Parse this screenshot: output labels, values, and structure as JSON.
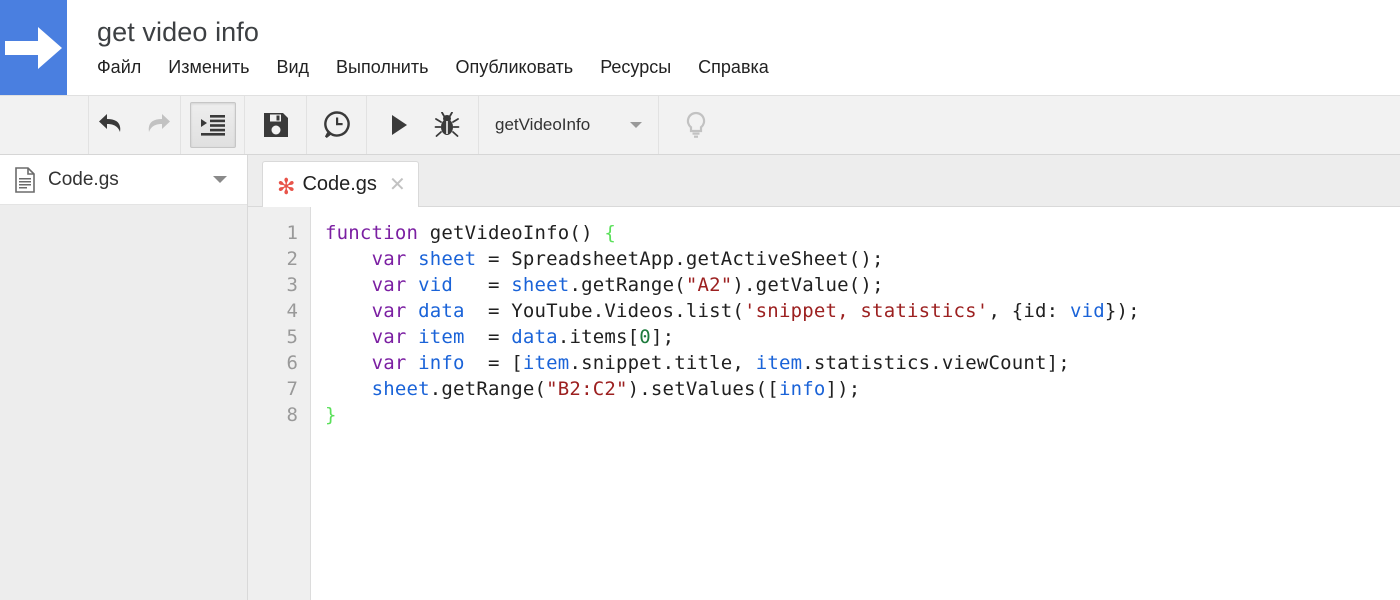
{
  "header": {
    "logo_icon": "apps-script-arrow-logo",
    "title": "get video info",
    "menu": [
      {
        "label": "Файл"
      },
      {
        "label": "Изменить"
      },
      {
        "label": "Вид"
      },
      {
        "label": "Выполнить"
      },
      {
        "label": "Опубликовать"
      },
      {
        "label": "Ресурсы"
      },
      {
        "label": "Справка"
      }
    ]
  },
  "toolbar": {
    "undo": {
      "icon": "undo-icon",
      "enabled": true
    },
    "redo": {
      "icon": "redo-icon",
      "enabled": false
    },
    "indent": {
      "icon": "indent-code-icon",
      "pressed": true
    },
    "save": {
      "icon": "save-floppy-icon"
    },
    "history": {
      "icon": "clock-history-icon"
    },
    "run": {
      "icon": "run-play-icon"
    },
    "debug": {
      "icon": "debug-bug-icon"
    },
    "function_select": {
      "value": "getVideoInfo",
      "caret_icon": "chevron-down-icon"
    },
    "hint": {
      "icon": "lightbulb-icon",
      "enabled": false
    }
  },
  "sidebar": {
    "file": {
      "icon": "file-document-icon",
      "name": "Code.gs",
      "caret_icon": "chevron-down-icon"
    }
  },
  "editor": {
    "tab": {
      "dirty_marker": "✻",
      "label": "Code.gs",
      "close_icon": "✕"
    },
    "line_numbers": [
      "1",
      "2",
      "3",
      "4",
      "5",
      "6",
      "7",
      "8"
    ],
    "code_lines": [
      [
        {
          "t": "function ",
          "c": "kw"
        },
        {
          "t": "getVideoInfo() ",
          "c": "pl"
        },
        {
          "t": "{",
          "c": "br"
        }
      ],
      [
        {
          "t": "    ",
          "c": "pl"
        },
        {
          "t": "var ",
          "c": "kw"
        },
        {
          "t": "sheet",
          "c": "var"
        },
        {
          "t": " = SpreadsheetApp.getActiveSheet();",
          "c": "pl"
        }
      ],
      [
        {
          "t": "    ",
          "c": "pl"
        },
        {
          "t": "var ",
          "c": "kw"
        },
        {
          "t": "vid",
          "c": "var"
        },
        {
          "t": "   = ",
          "c": "pl"
        },
        {
          "t": "sheet",
          "c": "var"
        },
        {
          "t": ".getRange(",
          "c": "pl"
        },
        {
          "t": "\"A2\"",
          "c": "str"
        },
        {
          "t": ").getValue();",
          "c": "pl"
        }
      ],
      [
        {
          "t": "    ",
          "c": "pl"
        },
        {
          "t": "var ",
          "c": "kw"
        },
        {
          "t": "data",
          "c": "var"
        },
        {
          "t": "  = YouTube.Videos.list(",
          "c": "pl"
        },
        {
          "t": "'snippet, statistics'",
          "c": "str"
        },
        {
          "t": ", {id: ",
          "c": "pl"
        },
        {
          "t": "vid",
          "c": "var"
        },
        {
          "t": "});",
          "c": "pl"
        }
      ],
      [
        {
          "t": "    ",
          "c": "pl"
        },
        {
          "t": "var ",
          "c": "kw"
        },
        {
          "t": "item",
          "c": "var"
        },
        {
          "t": "  = ",
          "c": "pl"
        },
        {
          "t": "data",
          "c": "var"
        },
        {
          "t": ".items[",
          "c": "pl"
        },
        {
          "t": "0",
          "c": "num"
        },
        {
          "t": "];",
          "c": "pl"
        }
      ],
      [
        {
          "t": "    ",
          "c": "pl"
        },
        {
          "t": "var ",
          "c": "kw"
        },
        {
          "t": "info",
          "c": "var"
        },
        {
          "t": "  = [",
          "c": "pl"
        },
        {
          "t": "item",
          "c": "var"
        },
        {
          "t": ".snippet.title, ",
          "c": "pl"
        },
        {
          "t": "item",
          "c": "var"
        },
        {
          "t": ".statistics.viewCount];",
          "c": "pl"
        }
      ],
      [
        {
          "t": "    ",
          "c": "pl"
        },
        {
          "t": "sheet",
          "c": "var"
        },
        {
          "t": ".getRange(",
          "c": "pl"
        },
        {
          "t": "\"B2:C2\"",
          "c": "str"
        },
        {
          "t": ").setValues([",
          "c": "pl"
        },
        {
          "t": "info",
          "c": "var"
        },
        {
          "t": "]);",
          "c": "pl"
        }
      ],
      [
        {
          "t": "}",
          "c": "br"
        }
      ]
    ]
  },
  "colors": {
    "logo_blue": "#4a7fe0",
    "toolbar_bg": "#f2f2f2",
    "sidebar_bg": "#ededed",
    "gutter_bg": "#efefef",
    "dirty_red": "#e8544a",
    "keyword_purple": "#7b1fa2",
    "variable_blue": "#1a63d8",
    "string_red": "#9c2020",
    "number_green": "#1d7a3c",
    "brace_green": "#5ae05a"
  }
}
